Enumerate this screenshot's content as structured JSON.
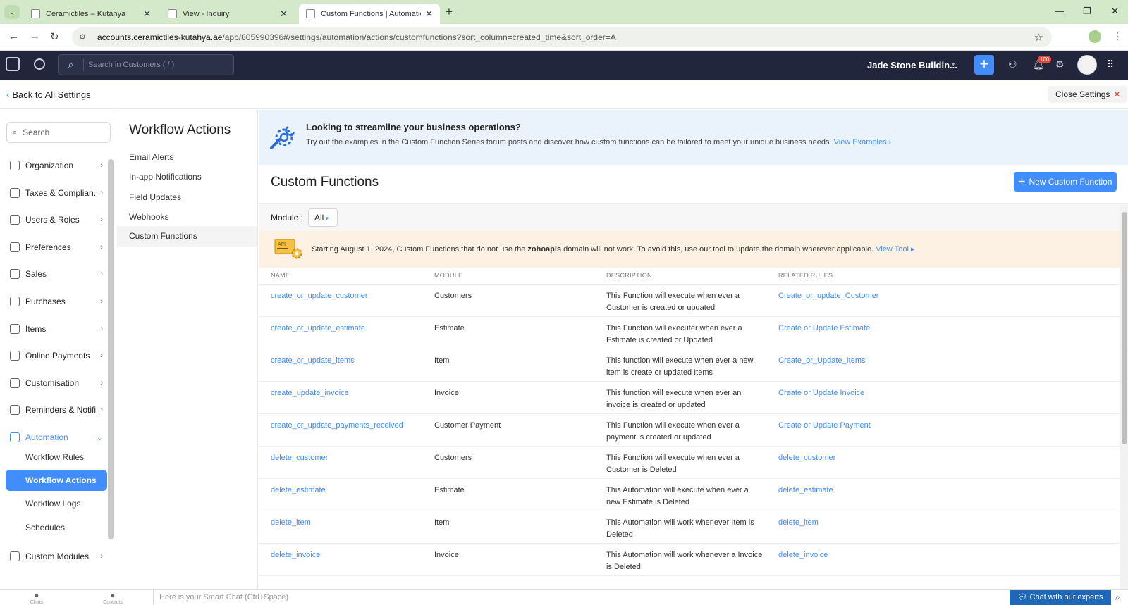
{
  "browser": {
    "tabs": [
      {
        "title": "Ceramictiles – Kutahya"
      },
      {
        "title": "View - Inquiry"
      },
      {
        "title": "Custom Functions | Automatio"
      }
    ],
    "url_host": "accounts.ceramictiles-kutahya.ae",
    "url_path": "/app/805990396#/settings/automation/actions/customfunctions?sort_column=created_time&sort_order=A"
  },
  "header": {
    "search_placeholder": "Search in Customers ( / )",
    "org_name": "Jade Stone Buildin...",
    "notification_count": "100"
  },
  "settings_bar": {
    "back_label": "Back to All Settings",
    "close_label": "Close Settings"
  },
  "sidebar": {
    "search_placeholder": "Search",
    "items": [
      {
        "label": "Organization"
      },
      {
        "label": "Taxes & Complian..."
      },
      {
        "label": "Users & Roles"
      },
      {
        "label": "Preferences"
      },
      {
        "label": "Sales"
      },
      {
        "label": "Purchases"
      },
      {
        "label": "Items"
      },
      {
        "label": "Online Payments"
      },
      {
        "label": "Customisation"
      },
      {
        "label": "Reminders & Notifi..."
      },
      {
        "label": "Automation"
      },
      {
        "label": "Custom Modules"
      }
    ],
    "automation_sub": [
      {
        "label": "Workflow Rules"
      },
      {
        "label": "Workflow Actions"
      },
      {
        "label": "Workflow Logs"
      },
      {
        "label": "Schedules"
      }
    ]
  },
  "workflow_actions": {
    "title": "Workflow Actions",
    "items": [
      {
        "label": "Email Alerts"
      },
      {
        "label": "In-app Notifications"
      },
      {
        "label": "Field Updates"
      },
      {
        "label": "Webhooks"
      },
      {
        "label": "Custom Functions"
      }
    ]
  },
  "promo": {
    "heading": "Looking to streamline your business operations?",
    "text": "Try out the examples in the Custom Function Series forum posts and discover how custom functions can be tailored to meet your unique business needs.",
    "link": "View Examples ›"
  },
  "main": {
    "title": "Custom Functions",
    "new_button": "New Custom Function",
    "module_label": "Module :",
    "module_value": "All"
  },
  "notice": {
    "before": "Starting August 1, 2024, Custom Functions that do not use the",
    "bold": "zohoapis",
    "after": "domain will not work. To avoid this, use our tool to update the domain wherever applicable.",
    "link": "View Tool ▸"
  },
  "table": {
    "headers": [
      "NAME",
      "MODULE",
      "DESCRIPTION",
      "RELATED RULES"
    ],
    "rows": [
      {
        "name": "create_or_update_customer",
        "module": "Customers",
        "desc1": "This Function will execute when ever a",
        "desc2": "Customer is created or updated",
        "rule": "Create_or_update_Customer"
      },
      {
        "name": "create_or_update_estimate",
        "module": "Estimate",
        "desc1": "This Function will executer when ever a",
        "desc2": "Estimate is created or Updated",
        "rule": "Create or Update Estimate"
      },
      {
        "name": "create_or_update_items",
        "module": "Item",
        "desc1": "This function will execute when ever a new",
        "desc2": "item is create or updated Items",
        "rule": "Create_or_Update_Items"
      },
      {
        "name": "create_update_invoice",
        "module": "Invoice",
        "desc1": "This function will execute when ever an",
        "desc2": "invoice is created or updated",
        "rule": "Create or Update Invoice"
      },
      {
        "name": "create_or_update_payments_received",
        "module": "Customer Payment",
        "desc1": "This Function will execute when ever a",
        "desc2": "payment is created or updated",
        "rule": "Create or Update Payment"
      },
      {
        "name": "delete_customer",
        "module": "Customers",
        "desc1": "This Function will execute when ever a",
        "desc2": "Customer is Deleted",
        "rule": "delete_customer"
      },
      {
        "name": "delete_estimate",
        "module": "Estimate",
        "desc1": "This Automation will execute when ever a",
        "desc2": "new Estimate is Deleted",
        "rule": "delete_estimate"
      },
      {
        "name": "delete_item",
        "module": "Item",
        "desc1": "This Automation will work whenever Item is",
        "desc2": "Deleted",
        "rule": "delete_item"
      },
      {
        "name": "delete_invoice",
        "module": "Invoice",
        "desc1": "This Automation will work whenever a Invoice",
        "desc2": "is Deleted",
        "rule": "delete_invoice"
      }
    ]
  },
  "bottom": {
    "chats_label": "Chats",
    "contacts_label": "Contacts",
    "smart_chat_placeholder": "Here is your Smart Chat (Ctrl+Space)",
    "chat_button": "Chat with our experts"
  },
  "colors": {
    "accent": "#408dfb",
    "header_bg": "#21263c",
    "promo_bg": "#eaf2fc",
    "notice_bg": "#fdf1e3"
  }
}
